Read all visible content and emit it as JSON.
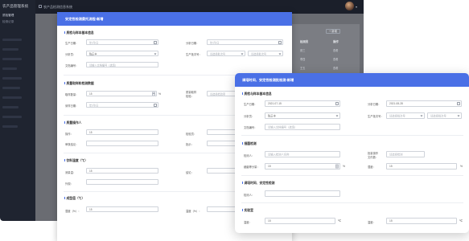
{
  "app": {
    "brand": "农产品管理系统",
    "title": "农产品检测信息系统",
    "sidebar_items": [
      "质检管理",
      "检测记录"
    ],
    "bg_table": {
      "action_label": "+ 新增",
      "headers": [
        "检测员",
        "操作"
      ],
      "rows": [
        [
          "张三",
          "查看"
        ],
        [
          "李四",
          "查看"
        ],
        [
          "王五",
          "查看"
        ],
        [
          "赵六",
          "查看"
        ],
        [
          "孙七",
          "查看"
        ]
      ]
    }
  },
  "dialog_back": {
    "title": "安定性检测委托流程-新增",
    "sec_basic": "质检与样本基本信息",
    "production_date_label": "生产日期：",
    "production_date_ph": "年/月/日",
    "analysis_date_label": "分析日期：",
    "analysis_date_ph": "年/月/日",
    "analyst_label": "分析员：",
    "analyst_value": "陈正丰",
    "batch_label": "生产批次号：",
    "batch_ph": "请选择批次号",
    "batch_ph2": "请选择批次号",
    "doc_no_label": "文档编号：",
    "doc_no_ph": "请输入文档编号（选填）",
    "sec_sample": "质量取样和检测数据",
    "sample_qty_label": "取样数量：",
    "sample_qty_value": "15",
    "sample_unit": "%",
    "qc_label": "质量取样",
    "qc_label2": "检验：",
    "qc_ph": "请选择检验项",
    "sampling_date_label": "采样日期：",
    "sampling_date_ph": "年/月/日",
    "sec_operator": "质量操作人",
    "operator_label": "操作：",
    "operator_value": "15",
    "checker_label": "检验员：",
    "reviewer_label": "审核结论：",
    "approver_label": "批示：",
    "sec_temp": "饮料温度（℃）",
    "temp_label": "测量温：",
    "temp_value": "15",
    "result_label": "结论：",
    "remark_label": "外观：",
    "sec_humidity": "成型值（℃）",
    "humidity_label": "湿度（%）：",
    "humidity_value": "15",
    "temp2_label": "温度（%）："
  },
  "dialog_front": {
    "title": "调培时间、安定性检测批检测-新增",
    "sec_basic": "质检与样本基本信息",
    "production_date_label": "生产日期：",
    "production_date_value": "2021-07-15",
    "analysis_date_label": "分析日期：",
    "analysis_date_value": "2021-08-28",
    "analyst_label": "分析员：",
    "analyst_value": "陈正丰",
    "batch_label": "生产批次号：",
    "batch_ph": "请选择批次号",
    "batch_ph2": "请选择批次号",
    "doc_no_label": "文档编号：",
    "doc_no_ph": "请输入文档编号（选填）",
    "sec_detect": "细菌检测",
    "detector_label": "检测人：",
    "detector_ph": "请输入检测人名称",
    "lot_label": "批量操作",
    "lot_label2": "文件数：",
    "lot_ph": "请选择检测",
    "bacteria_label": "细菌等分量：",
    "bacteria_value": "15",
    "bacteria_unit": "%",
    "humidity_label": "湿度：",
    "humidity_value": "15",
    "humidity_unit": "%",
    "sec_time": "调培时间、安定性检测",
    "time_detector_label": "检测人：",
    "sec_lab": "实验室",
    "temp_label": "温度：",
    "temp_value": "15",
    "temp_unit": "℃",
    "temp2_label": "温度：",
    "temp2_value": "15",
    "temp2_unit": "℃"
  }
}
